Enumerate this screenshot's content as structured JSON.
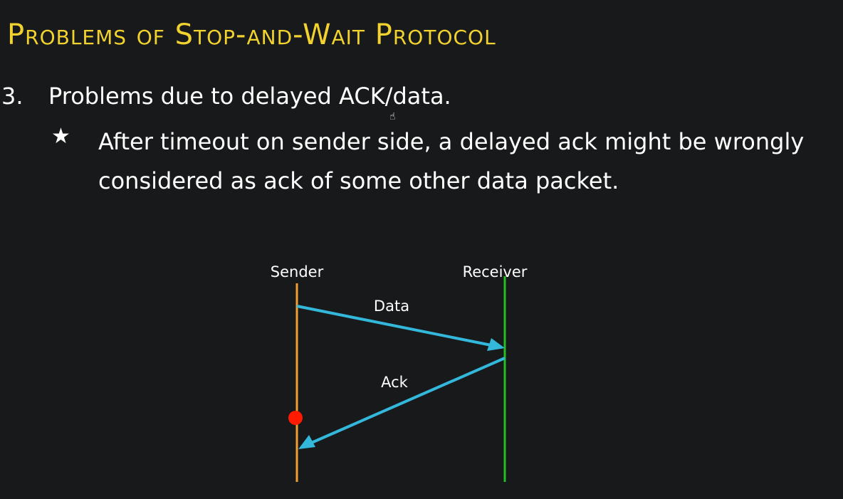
{
  "slide": {
    "title": "Problems of Stop-and-Wait Protocol",
    "point": {
      "number": "3.",
      "text": "Problems due to delayed ACK/data."
    },
    "bullet": {
      "marker": "★",
      "text": "After timeout on sender side, a delayed ack might be wrongly considered as ack of some other data packet."
    }
  },
  "diagram": {
    "sender_label": "Sender",
    "receiver_label": "Receiver",
    "data_label": "Data",
    "ack_label": "Ack",
    "colors": {
      "sender_line": "#f0a030",
      "receiver_line": "#22c022",
      "arrow": "#33b8dc",
      "timeout_dot": "#ff1a00",
      "text": "#ffffff"
    }
  }
}
